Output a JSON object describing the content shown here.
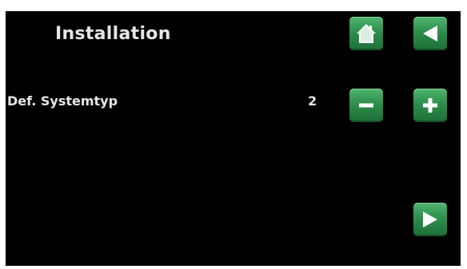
{
  "header": {
    "title": "Installation"
  },
  "parameter": {
    "label": "Def. Systemtyp",
    "value": "2"
  },
  "buttons": {
    "home": "home-icon",
    "back": "back-arrow-icon",
    "decrease": "minus-icon",
    "increase": "plus-icon",
    "next": "next-arrow-icon"
  },
  "colors": {
    "background": "#000000",
    "button_green": "#2e8e4c",
    "text": "#e6e6e6"
  }
}
